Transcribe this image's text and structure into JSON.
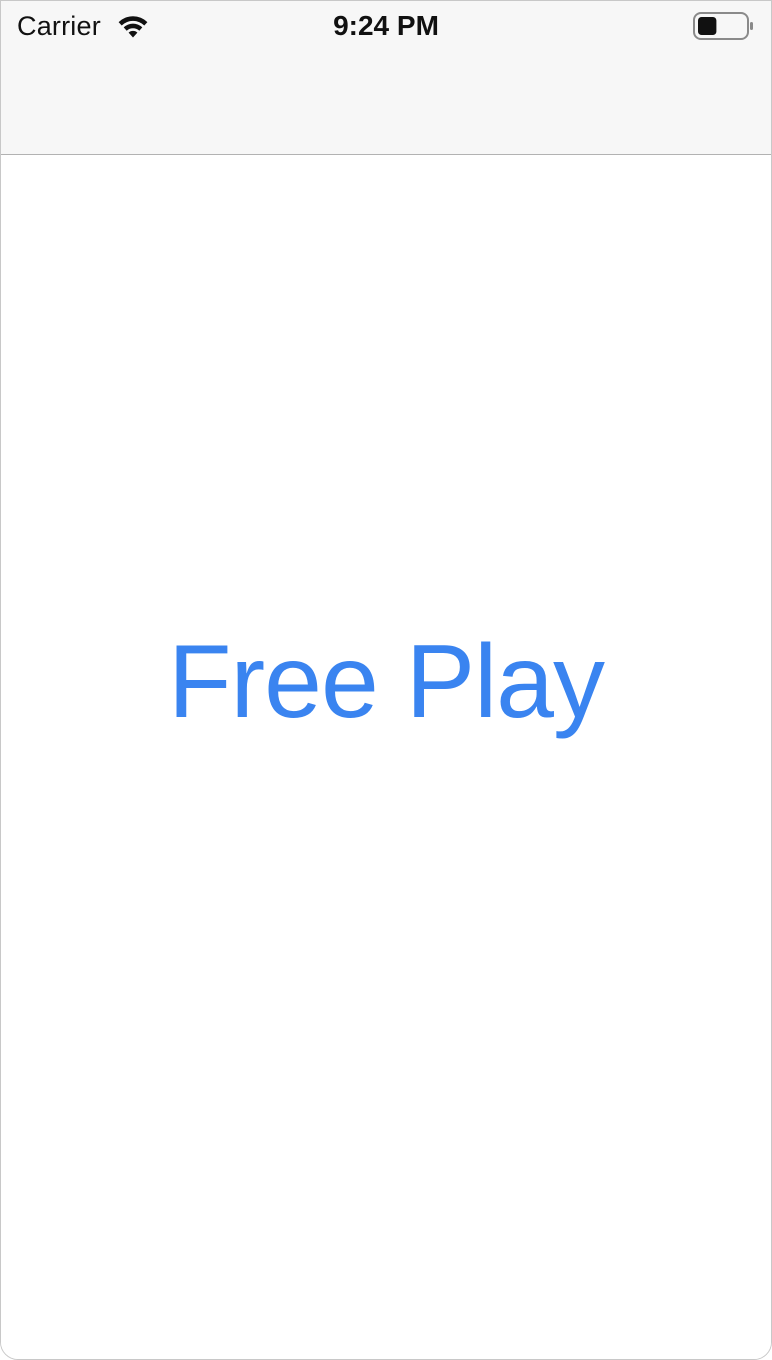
{
  "status_bar": {
    "carrier": "Carrier",
    "time": "9:24 PM",
    "icons": {
      "wifi": "wifi-icon",
      "battery": "battery-icon"
    },
    "battery_level": 0.4
  },
  "navigation_bar": {
    "title": ""
  },
  "main": {
    "free_play_label": "Free Play"
  },
  "colors": {
    "accent": "#3a84f0",
    "bar_background": "#f7f7f7",
    "separator": "#b2b2b2",
    "text": "#111111"
  }
}
